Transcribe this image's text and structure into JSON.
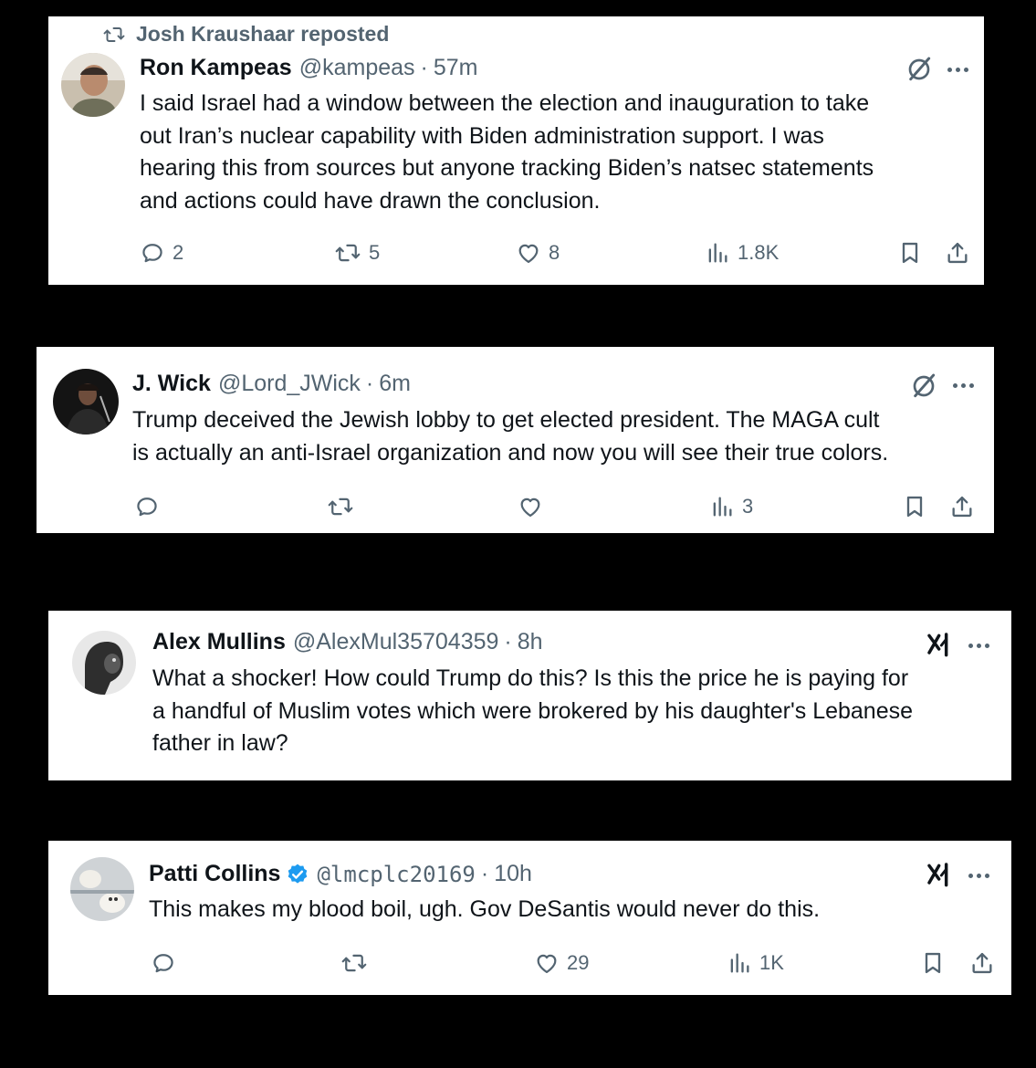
{
  "posts": [
    {
      "repost_by": "Josh Kraushaar reposted",
      "name": "Ron Kampeas",
      "handle": "@kampeas",
      "separator": "·",
      "time": "57m",
      "text_lines": [
        "I said Israel had a window between the election and inauguration to take",
        "out Iran’s nuclear capability with Biden administration support. I was",
        "hearing this from sources but anyone tracking Biden’s natsec statements",
        "and actions could have drawn the conclusion."
      ],
      "replies": "2",
      "reposts": "5",
      "likes": "8",
      "views": "1.8K"
    },
    {
      "name": "J. Wick",
      "handle": "@Lord_JWick",
      "separator": "·",
      "time": "6m",
      "text_lines": [
        "Trump deceived the Jewish lobby to get elected president. The MAGA cult",
        "is actually an anti-Israel organization and now you will see their true colors."
      ],
      "replies": "",
      "reposts": "",
      "likes": "",
      "views": "3"
    },
    {
      "name": "Alex Mullins",
      "handle": "@AlexMul35704359",
      "separator": "·",
      "time": "8h",
      "text_lines": [
        "What a shocker! How could Trump do this? Is this the price he is paying for",
        "a handful of Muslim votes which were brokered by his daughter's Lebanese",
        "father in law?"
      ]
    },
    {
      "name": "Patti Collins",
      "handle": "@lmcplc20169",
      "separator": "·",
      "time": "10h",
      "text_lines": [
        "This makes my blood boil, ugh. Gov DeSantis would never do this."
      ],
      "replies": "",
      "reposts": "",
      "likes": "29",
      "views": "1K"
    }
  ],
  "icons": {
    "repost": "repost-icon",
    "reply": "reply-icon",
    "like": "heart-icon",
    "views": "views-icon",
    "bookmark": "bookmark-icon",
    "share": "share-icon",
    "grok": "grok-icon",
    "more": "more-icon",
    "verified": "verified-badge-icon"
  },
  "colors": {
    "background": "#000000",
    "card": "#ffffff",
    "text": "#0f1419",
    "secondary": "#536471",
    "verified": "#1d9bf0"
  }
}
